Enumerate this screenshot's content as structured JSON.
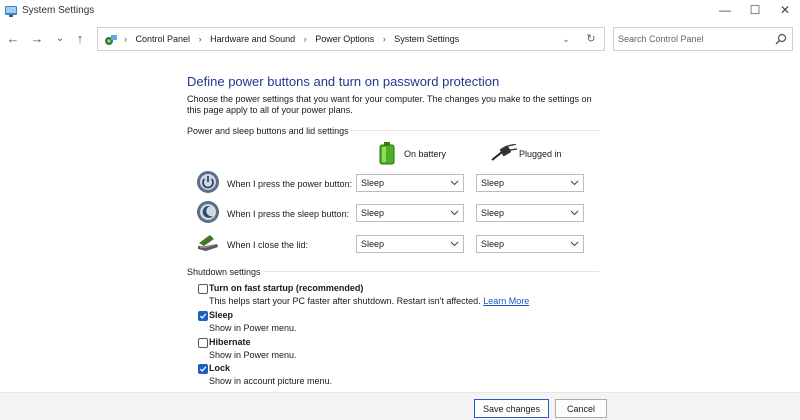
{
  "window": {
    "title": "System Settings",
    "minimize": "—",
    "maximize": "☐",
    "close": "✕"
  },
  "nav": {
    "back": "←",
    "forward": "→",
    "recent": "⌄",
    "up": "↑"
  },
  "address": {
    "crumbs": [
      "Control Panel",
      "Hardware and Sound",
      "Power Options",
      "System Settings"
    ],
    "separator": "›",
    "dropdown": "⌄",
    "refresh": "↻"
  },
  "search": {
    "placeholder": "Search Control Panel"
  },
  "main": {
    "title": "Define power buttons and turn on password protection",
    "description": "Choose the power settings that you want for your computer. The changes you make to the settings on this page apply to all of your power plans.",
    "power_section": {
      "header": "Power and sleep buttons and lid settings",
      "col_battery": "On battery",
      "col_plugged": "Plugged in",
      "rows": [
        {
          "label": "When I press the power button:",
          "battery": "Sleep",
          "plugged": "Sleep"
        },
        {
          "label": "When I press the sleep button:",
          "battery": "Sleep",
          "plugged": "Sleep"
        },
        {
          "label": "When I close the lid:",
          "battery": "Sleep",
          "plugged": "Sleep"
        }
      ]
    },
    "shutdown_section": {
      "header": "Shutdown settings",
      "options": [
        {
          "label": "Turn on fast startup (recommended)",
          "desc": "This helps start your PC faster after shutdown. Restart isn't affected.",
          "link": "Learn More",
          "checked": false
        },
        {
          "label": "Sleep",
          "desc": "Show in Power menu.",
          "checked": true
        },
        {
          "label": "Hibernate",
          "desc": "Show in Power menu.",
          "checked": false
        },
        {
          "label": "Lock",
          "desc": "Show in account picture menu.",
          "checked": true
        }
      ]
    }
  },
  "footer": {
    "save": "Save changes",
    "cancel": "Cancel"
  },
  "colors": {
    "title_blue": "#1e3a8a",
    "link_blue": "#1a56c4",
    "check_blue": "#1f5fbf"
  }
}
